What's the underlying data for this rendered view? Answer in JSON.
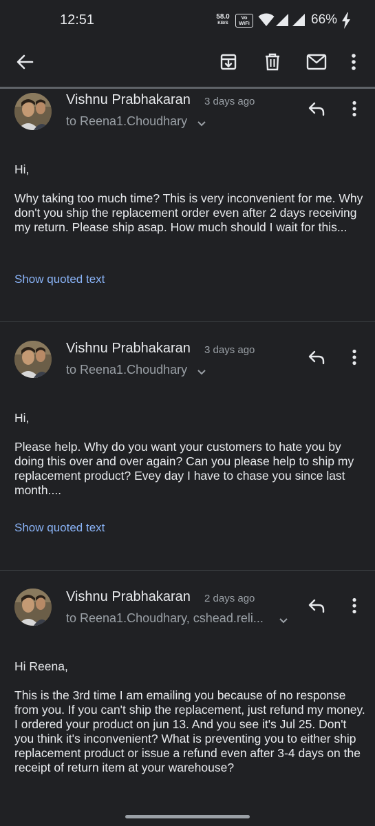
{
  "status_bar": {
    "time": "12:51",
    "net_speed_value": "58.0",
    "net_speed_unit": "KB/S",
    "wifi_call_line1": "Vo",
    "wifi_call_line2": "WiFi",
    "battery_percent": "66%"
  },
  "toolbar": {
    "icons": [
      "back-arrow-icon",
      "archive-icon",
      "delete-icon",
      "mark-unread-icon",
      "more-vert-icon"
    ]
  },
  "messages": [
    {
      "sender": "Vishnu Prabhakaran",
      "time": "3 days ago",
      "recipients": "to Reena1.Choudhary",
      "greeting": "Hi,",
      "body": "Why taking too much time? This is very inconvenient for me. Why don't you ship the replacement order even after 2 days receiving my return. Please ship asap. How much should I wait for this...",
      "quoted_link": "Show quoted text"
    },
    {
      "sender": "Vishnu Prabhakaran",
      "time": "3 days ago",
      "recipients": "to Reena1.Choudhary",
      "greeting": "Hi,",
      "body": "Please help. Why do you want your customers to hate you by doing this over and over again? Can you please help to ship my replacement product? Evey day I have to chase you since last month....",
      "quoted_link": "Show quoted text"
    },
    {
      "sender": "Vishnu Prabhakaran",
      "time": "2 days ago",
      "recipients": "to Reena1.Choudhary, cshead.reli...",
      "greeting": "Hi Reena,",
      "body": "This is the 3rd time I am emailing you because of no response from you. If you can't ship the replacement, just refund my money. I ordered your product on jun 13. And you see it's Jul 25. Don't you think it's inconvenient? What is preventing you to either ship replacement product or issue a refund even after 3-4 days on the receipt of return item at your warehouse?"
    }
  ],
  "colors": {
    "background": "#202124",
    "text": "#e8eaed",
    "secondary_text": "#9aa0a6",
    "link": "#8ab4f8",
    "divider": "#3c4043"
  }
}
